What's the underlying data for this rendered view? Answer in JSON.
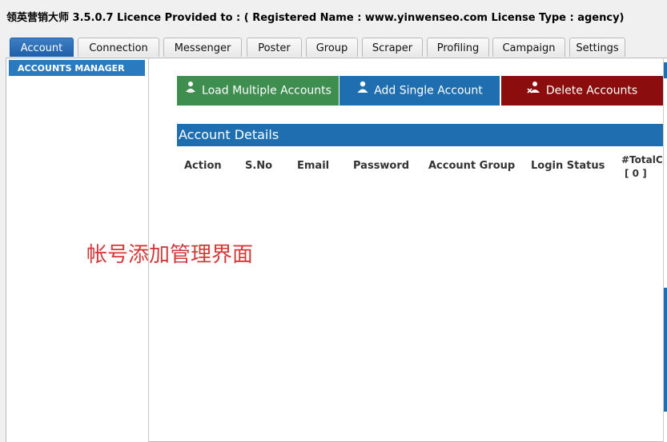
{
  "window": {
    "title": "领英营销大师 3.5.0.7 Licence Provided to : ( Registered Name : www.yinwenseo.com License Type : agency)"
  },
  "tabs": [
    {
      "label": "Account",
      "active": true
    },
    {
      "label": "Connection"
    },
    {
      "label": "Messenger"
    },
    {
      "label": "Poster"
    },
    {
      "label": "Group"
    },
    {
      "label": "Scraper"
    },
    {
      "label": "Profiling"
    },
    {
      "label": "Campaign"
    },
    {
      "label": "Settings"
    }
  ],
  "sidebar": {
    "header": "ACCOUNTS MANAGER"
  },
  "toolbar": {
    "load_label": "Load Multiple Accounts",
    "add_label": "Add Single Account",
    "delete_label": "Delete Accounts"
  },
  "details": {
    "title": "Account Details",
    "columns": [
      "Action",
      "S.No",
      "Email",
      "Password",
      "Account Group",
      "Login Status",
      "#TotalCo"
    ],
    "total_count": "[ 0 ]"
  },
  "annotation": "帐号添加管理界面",
  "colors": {
    "accent_blue": "#1f6fb0",
    "load_green": "#3e8e50",
    "delete_red": "#8b0d0d",
    "annotation_red": "#d23a3a"
  }
}
